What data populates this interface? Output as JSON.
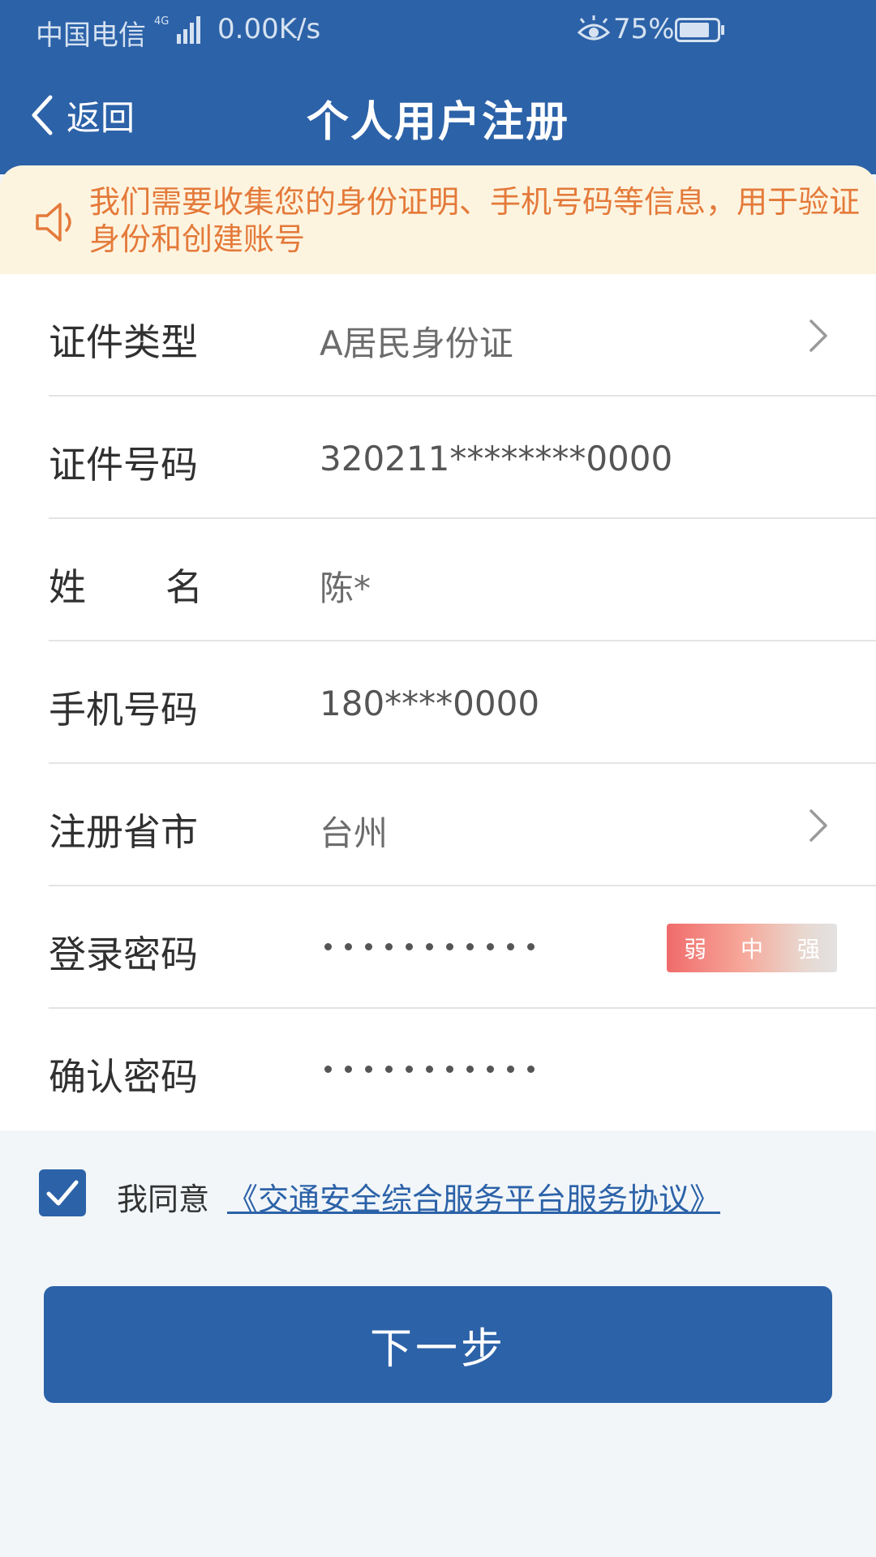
{
  "status_bar": {
    "carrier": "中国电信",
    "network_type": "4G",
    "net_speed": "0.00K/s",
    "battery_percent": "75%"
  },
  "nav": {
    "back_label": "返回",
    "title": "个人用户注册"
  },
  "notice": {
    "text": "我们需要收集您的身份证明、手机号码等信息，用于验证身份和创建账号",
    "icon": "speaker-icon"
  },
  "form": {
    "id_type": {
      "label": "证件类型",
      "value": "A居民身份证"
    },
    "id_number": {
      "label": "证件号码",
      "value": "320211********0000"
    },
    "name": {
      "label_first": "姓",
      "label_second": "名",
      "value": "陈*"
    },
    "phone": {
      "label": "手机号码",
      "value": "180****0000"
    },
    "region": {
      "label": "注册省市",
      "value": "台州"
    },
    "password": {
      "label": "登录密码",
      "masked_length": 11,
      "strength_labels": {
        "weak": "弱",
        "medium": "中",
        "strong": "强"
      }
    },
    "confirm_password": {
      "label": "确认密码",
      "masked_length": 11
    }
  },
  "agreement": {
    "checked": true,
    "prefix": "我同意",
    "link_text": "《交通安全综合服务平台服务协议》"
  },
  "next_button": {
    "label": "下一步"
  },
  "colors": {
    "primary": "#2c62a8",
    "notice_bg": "#fdf4e0",
    "notice_text": "#e47a3a",
    "page_bg": "#f2f6f9"
  }
}
